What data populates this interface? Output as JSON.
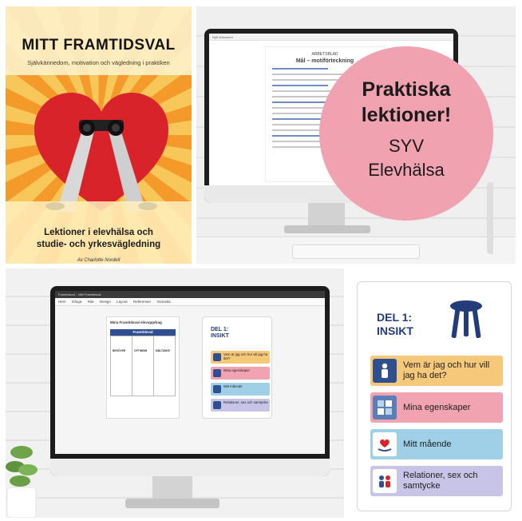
{
  "cover": {
    "title": "MITT FRAMTIDSVAL",
    "subtitle": "Självkännedom, motivation och vägledning i praktiken",
    "line1": "Lektioner i elevhälsa och",
    "line2": "studie- och yrkesvägledning",
    "author": "Av Charlotte Nordell",
    "colors": {
      "ray_dark": "#f39a2a",
      "ray_light": "#f7c75a",
      "heart": "#d8232a"
    }
  },
  "promo": {
    "line1": "Praktiska",
    "line2": "lektioner!",
    "line3": "SYV",
    "line4": "Elevhälsa",
    "circle_color": "#f1a2b0"
  },
  "doc_screen": {
    "tab": "Nytt dokument",
    "heading": "ARBETSBLAD",
    "title": "Mål – motiförteckning"
  },
  "app_screen": {
    "window_title": "Framtidsval – Mitt Framtidsval",
    "menu": [
      "Hem",
      "Infoga",
      "Rita",
      "Design",
      "Layout",
      "Referenser",
      "Granska"
    ],
    "left_title": "Mina Framtidsval elevuppdrag",
    "table_title": "Framtidsval",
    "columns": [
      "BEHÖVER",
      "OPTIMISM",
      "MÅLTANKE"
    ]
  },
  "mini_card": {
    "del": "DEL 1:",
    "insikt": "INSIKT",
    "items": [
      "Vem är jag och hur vill jag ha det?",
      "Mina egenskaper",
      "Mitt mående",
      "Relationer, sex och samtycke"
    ]
  },
  "card": {
    "del": "DEL 1:",
    "insikt": "INSIKT",
    "items": [
      {
        "label": "Vem är jag och hur vill jag ha det?",
        "bg": "#f6c87a",
        "icon": "person-icon"
      },
      {
        "label": "Mina egenskaper",
        "bg": "#f1a3b1",
        "icon": "puzzle-icon"
      },
      {
        "label": "Mitt mående",
        "bg": "#9fd0e8",
        "icon": "heart-hand-icon"
      },
      {
        "label": "Relationer, sex och samtycke",
        "bg": "#c8c4e8",
        "icon": "people-icon"
      }
    ],
    "accent": "#223d7a"
  }
}
